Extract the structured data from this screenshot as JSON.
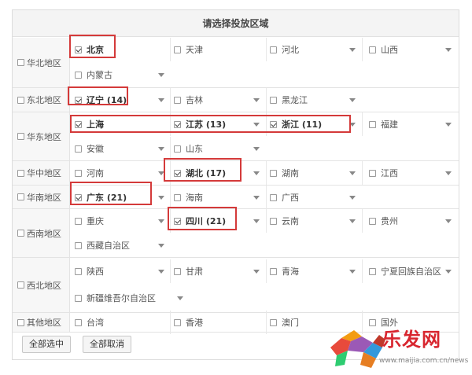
{
  "title": "请选择投放区域",
  "regions": [
    {
      "name": "华北地区",
      "checked": false,
      "items": [
        {
          "label": "北京",
          "checked": true,
          "dropdown": false
        },
        {
          "label": "天津",
          "checked": false,
          "dropdown": false
        },
        {
          "label": "河北",
          "checked": false,
          "dropdown": true
        },
        {
          "label": "山西",
          "checked": false,
          "dropdown": true
        },
        {
          "label": "内蒙古",
          "checked": false,
          "dropdown": true
        }
      ]
    },
    {
      "name": "东北地区",
      "checked": false,
      "items": [
        {
          "label": "辽宁 (14)",
          "checked": true,
          "dropdown": true
        },
        {
          "label": "吉林",
          "checked": false,
          "dropdown": true
        },
        {
          "label": "黑龙江",
          "checked": false,
          "dropdown": true
        }
      ]
    },
    {
      "name": "华东地区",
      "checked": false,
      "items": [
        {
          "label": "上海",
          "checked": true,
          "dropdown": false
        },
        {
          "label": "江苏 (13)",
          "checked": true,
          "dropdown": true
        },
        {
          "label": "浙江 (11)",
          "checked": true,
          "dropdown": true
        },
        {
          "label": "福建",
          "checked": false,
          "dropdown": true
        },
        {
          "label": "安徽",
          "checked": false,
          "dropdown": true
        },
        {
          "label": "山东",
          "checked": false,
          "dropdown": true
        }
      ]
    },
    {
      "name": "华中地区",
      "checked": false,
      "items": [
        {
          "label": "河南",
          "checked": false,
          "dropdown": true
        },
        {
          "label": "湖北 (17)",
          "checked": true,
          "dropdown": true
        },
        {
          "label": "湖南",
          "checked": false,
          "dropdown": true
        },
        {
          "label": "江西",
          "checked": false,
          "dropdown": true
        }
      ]
    },
    {
      "name": "华南地区",
      "checked": false,
      "items": [
        {
          "label": "广东 (21)",
          "checked": true,
          "dropdown": true
        },
        {
          "label": "海南",
          "checked": false,
          "dropdown": true
        },
        {
          "label": "广西",
          "checked": false,
          "dropdown": true
        }
      ]
    },
    {
      "name": "西南地区",
      "checked": false,
      "items": [
        {
          "label": "重庆",
          "checked": false,
          "dropdown": true
        },
        {
          "label": "四川 (21)",
          "checked": true,
          "dropdown": true
        },
        {
          "label": "云南",
          "checked": false,
          "dropdown": true
        },
        {
          "label": "贵州",
          "checked": false,
          "dropdown": true
        },
        {
          "label": "西藏自治区",
          "checked": false,
          "dropdown": true
        }
      ]
    },
    {
      "name": "西北地区",
      "checked": false,
      "items": [
        {
          "label": "陕西",
          "checked": false,
          "dropdown": true
        },
        {
          "label": "甘肃",
          "checked": false,
          "dropdown": true
        },
        {
          "label": "青海",
          "checked": false,
          "dropdown": true
        },
        {
          "label": "宁夏回族自治区",
          "checked": false,
          "dropdown": true
        },
        {
          "label": "新疆维吾尔自治区",
          "checked": false,
          "dropdown": true
        }
      ]
    },
    {
      "name": "其他地区",
      "checked": false,
      "items": [
        {
          "label": "台湾",
          "checked": false,
          "dropdown": false
        },
        {
          "label": "香港",
          "checked": false,
          "dropdown": false
        },
        {
          "label": "澳门",
          "checked": false,
          "dropdown": false
        },
        {
          "label": "国外",
          "checked": false,
          "dropdown": false
        }
      ]
    }
  ],
  "buttons": {
    "select_all": "全部选中",
    "deselect_all": "全部取消"
  },
  "watermark": {
    "brand": "乐发网",
    "url": "www.maijia.com.cn/news"
  },
  "colors": {
    "highlight": "#d43a3a",
    "brand": "#d8262f"
  }
}
